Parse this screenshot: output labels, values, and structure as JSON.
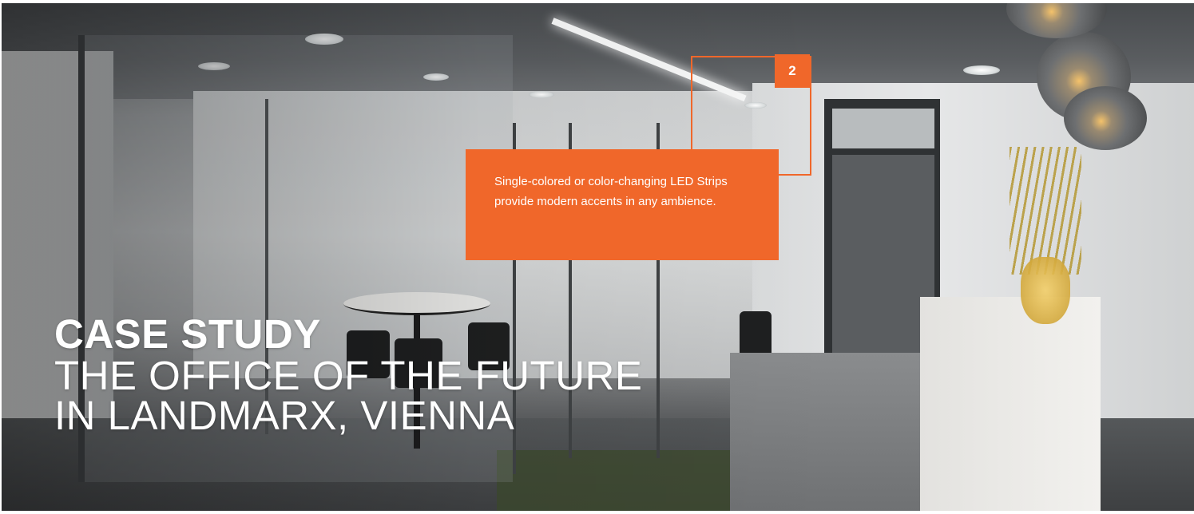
{
  "callout": {
    "marker": "2",
    "text": "Single-colored or color-changing LED Strips provide modern accents in any ambience."
  },
  "title": {
    "main": "CASE STUDY",
    "sub_line1": "THE OFFICE OF THE FUTURE",
    "sub_line2": "IN LANDMARX, VIENNA"
  },
  "colors": {
    "accent": "#f0672a",
    "title_text": "#ffffff"
  }
}
